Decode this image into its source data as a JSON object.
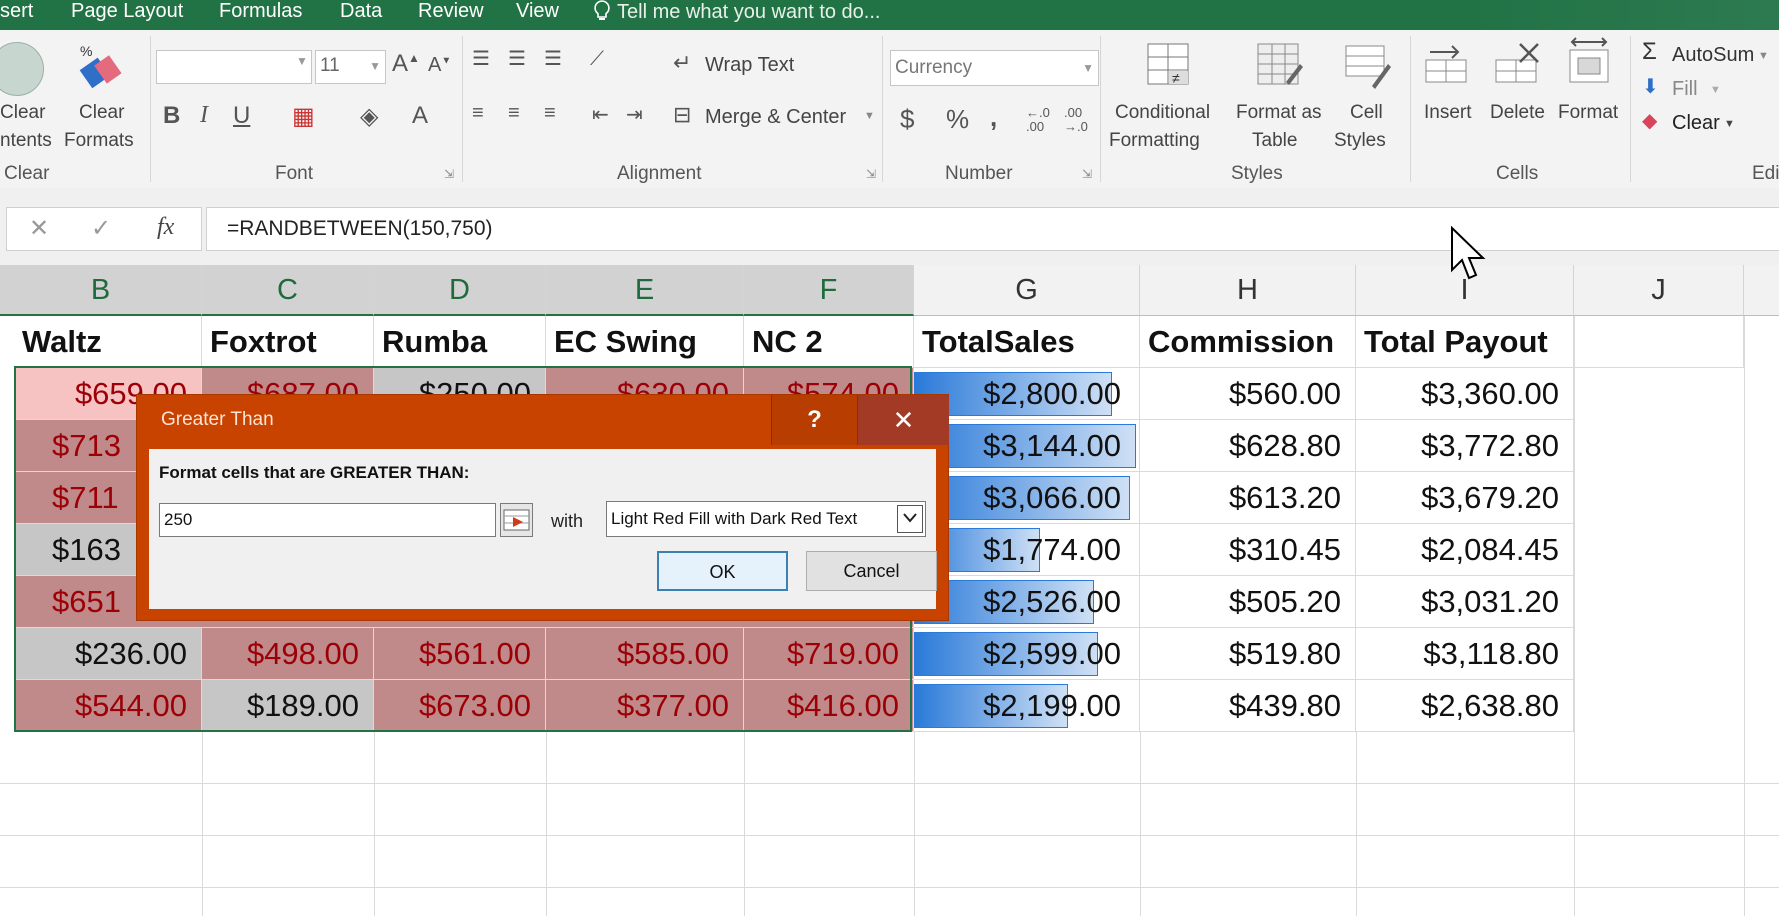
{
  "tabs": [
    "sert",
    "Page Layout",
    "Formulas",
    "Data",
    "Review",
    "View"
  ],
  "tell_me": "Tell me what you want to do...",
  "ribbon": {
    "clear_contents": [
      "Clear",
      "ntents"
    ],
    "clear_formats": [
      "Clear",
      "Formats"
    ],
    "clear_group": "Clear",
    "font_group": "Font",
    "font_size": "11",
    "alignment_group": "Alignment",
    "wrap_text": "Wrap Text",
    "merge_center": "Merge & Center",
    "number_format": "Currency",
    "number_group": "Number",
    "conditional_formatting": [
      "Conditional",
      "Formatting"
    ],
    "format_as_table": [
      "Format as",
      "Table"
    ],
    "cell_styles": [
      "Cell",
      "Styles"
    ],
    "styles_group": "Styles",
    "insert": "Insert",
    "delete": "Delete",
    "format": "Format",
    "cells_group": "Cells",
    "autosum": "AutoSum",
    "fill": "Fill",
    "clear": "Clear",
    "editing_group": "Edi"
  },
  "formula": "=RANDBETWEEN(150,750)",
  "columns": [
    "B",
    "C",
    "D",
    "E",
    "F",
    "G",
    "H",
    "I",
    "J"
  ],
  "headers": [
    "Waltz",
    "Foxtrot",
    "Rumba",
    "EC Swing",
    "NC 2",
    "TotalSales",
    "Commission",
    "Total Payout"
  ],
  "rows": [
    {
      "b": "$659.00",
      "c": "$687.00",
      "d": "$250.00",
      "e": "$630.00",
      "f": "$574.00",
      "g": "$2,800.00",
      "h": "$560.00",
      "i": "$3,360.00"
    },
    {
      "b": "$713",
      "c": "",
      "d": "",
      "e": "",
      "f": "",
      "g": "$3,144.00",
      "h": "$628.80",
      "i": "$3,772.80"
    },
    {
      "b": "$711",
      "c": "",
      "d": "",
      "e": "",
      "f": "",
      "g": "$3,066.00",
      "h": "$613.20",
      "i": "$3,679.20"
    },
    {
      "b": "$163",
      "c": "",
      "d": "",
      "e": "",
      "f": "",
      "g": "$1,774.00",
      "h": "$310.45",
      "i": "$2,084.45"
    },
    {
      "b": "$651",
      "c": "",
      "d": "",
      "e": "",
      "f": "",
      "g": "$2,526.00",
      "h": "$505.20",
      "i": "$3,031.20"
    },
    {
      "b": "$236.00",
      "c": "$498.00",
      "d": "$561.00",
      "e": "$585.00",
      "f": "$719.00",
      "g": "$2,599.00",
      "h": "$519.80",
      "i": "$3,118.80"
    },
    {
      "b": "$544.00",
      "c": "$189.00",
      "d": "$673.00",
      "e": "$377.00",
      "f": "$416.00",
      "g": "$2,199.00",
      "h": "$439.80",
      "i": "$2,638.80"
    }
  ],
  "dialog": {
    "title": "Greater Than",
    "help": "?",
    "close": "✕",
    "prompt": "Format cells that are GREATER THAN:",
    "value": "250",
    "with": "with",
    "format_option": "Light Red Fill with Dark Red Text",
    "ok": "OK",
    "cancel": "Cancel"
  }
}
